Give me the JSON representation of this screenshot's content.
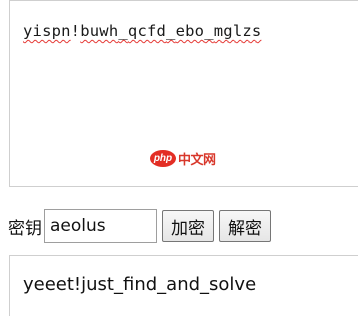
{
  "input": {
    "words": [
      "yispn",
      "!",
      "buwh",
      "_",
      "qcfd",
      "_",
      "ebo",
      "_",
      "mglzs"
    ],
    "misspelled_color": "#e53935"
  },
  "watermark": {
    "badge": "php",
    "text": "中文网",
    "color": "#e2231a"
  },
  "controls": {
    "key_label": "密钥",
    "key_value": "aeolus",
    "encrypt_label": "加密",
    "decrypt_label": "解密"
  },
  "output": {
    "text": "yeeet!just_find_and_solve"
  }
}
